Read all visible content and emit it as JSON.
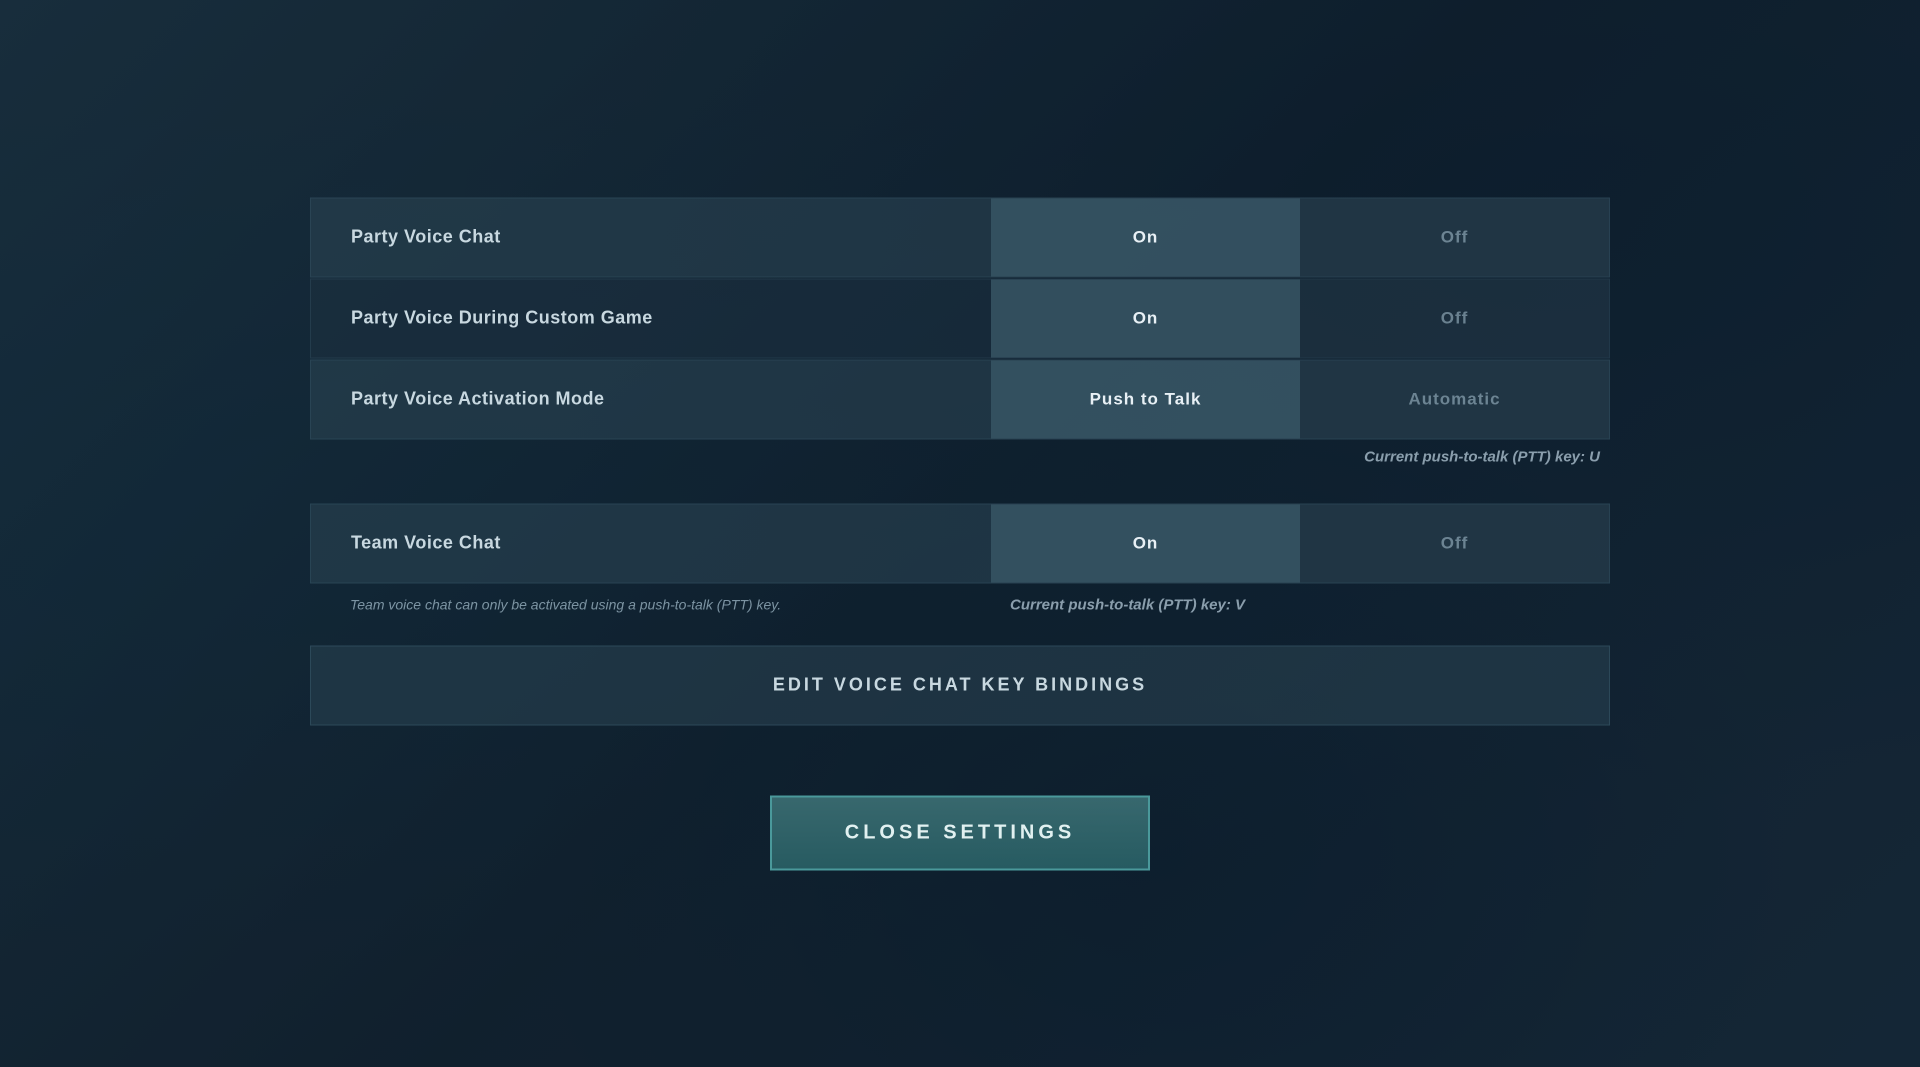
{
  "settings": {
    "party_voice_chat": {
      "label": "Party Voice Chat",
      "selected": "on",
      "on_label": "On",
      "off_label": "Off"
    },
    "party_voice_custom": {
      "label": "Party Voice During Custom Game",
      "selected": "on",
      "on_label": "On",
      "off_label": "Off"
    },
    "party_voice_activation": {
      "label": "Party Voice Activation Mode",
      "selected": "push_to_talk",
      "push_to_talk_label": "Push to Talk",
      "automatic_label": "Automatic"
    },
    "party_ptt_hint": "Current push-to-talk (PTT) key: U",
    "team_voice_chat": {
      "label": "Team Voice Chat",
      "selected": "on",
      "on_label": "On",
      "off_label": "Off"
    },
    "team_voice_note": "Team voice chat can only be activated using a push-to-talk (PTT) key.",
    "team_ptt_hint": "Current push-to-talk (PTT) key: V",
    "edit_bindings_label": "EDIT VOICE CHAT KEY BINDINGS",
    "close_settings_label": "CLOSE SETTINGS"
  }
}
